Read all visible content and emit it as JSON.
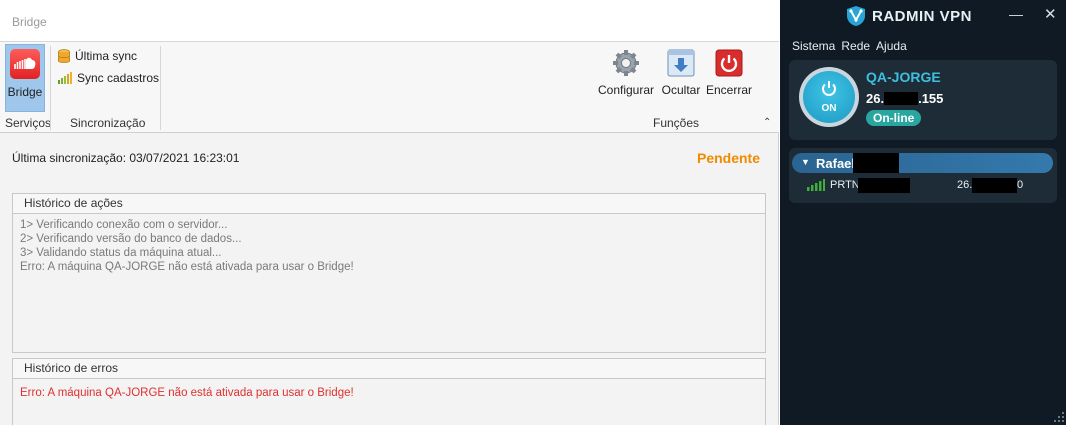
{
  "bridge": {
    "window_title": "Bridge",
    "ribbon": {
      "services": {
        "bridge_label": "Bridge",
        "group_label": "Serviços"
      },
      "sync": {
        "last_sync_label": "Última sync",
        "sync_registrations_label": "Sync cadastros",
        "group_label": "Sincronização"
      },
      "functions": {
        "configure_label": "Configurar",
        "hide_label": "Ocultar",
        "close_label": "Encerrar",
        "group_label": "Funções"
      }
    },
    "status": {
      "last_sync_text": "Última sincronização: 03/07/2021 16:23:01",
      "state": "Pendente",
      "state_color": "#f08a00"
    },
    "actions_history": {
      "title": "Histórico de ações",
      "lines": [
        "1> Verificando conexão com o servidor...",
        "2> Verificando versão do banco de dados...",
        "3> Validando status da máquina atual...",
        "Erro: A máquina QA-JORGE não está ativada para usar o Bridge!"
      ]
    },
    "errors_history": {
      "title": "Histórico de erros",
      "lines": [
        "Erro: A máquina QA-JORGE não está ativada para usar o Bridge!"
      ],
      "error_color": "#e03030"
    }
  },
  "radmin": {
    "brand": "RADMIN VPN",
    "menu": [
      "Sistema",
      "Rede",
      "Ajuda"
    ],
    "self": {
      "power_label": "ON",
      "name": "QA-JORGE",
      "ip_prefix": "26.",
      "ip_suffix": ".155",
      "status": "On-line"
    },
    "network": {
      "name": "Rafael",
      "peers": [
        {
          "name_prefix": "PRTN",
          "ip_prefix": "26.",
          "ip_suffix": "0",
          "signal_icon": "signal-bars-icon"
        }
      ]
    },
    "colors": {
      "accent": "#3bc0e0",
      "background": "#0f1a24",
      "card": "#1e2c38",
      "online_badge": "#2aa6a0"
    }
  }
}
